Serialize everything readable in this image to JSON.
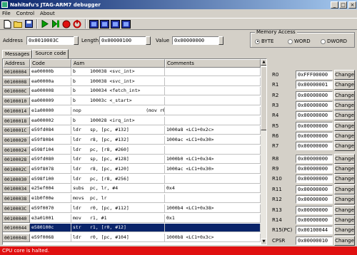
{
  "window": {
    "title": "Nahitafu's JTAG-ARM7 debugger",
    "min": "_",
    "max": "□",
    "close": "×"
  },
  "menu": [
    "File",
    "Control",
    "About"
  ],
  "toolbar": {
    "icons": [
      "new-icon",
      "open-icon",
      "save-icon",
      "run-icon",
      "step-icon",
      "stop-icon",
      "reset-icon",
      "chip-icon-1",
      "chip-icon-2",
      "chip-icon-3",
      "chip-icon-4"
    ]
  },
  "address_bar": {
    "address_label": "Address",
    "address_value": "0x0010003C",
    "length_label": "Length",
    "length_value": "0x00000100",
    "value_label": "Value",
    "value_value": "0x00000000"
  },
  "memory_access": {
    "legend": "Memory Access",
    "options": [
      "BYTE",
      "WORD",
      "DWORD"
    ],
    "selected": "BYTE"
  },
  "tabs": [
    "Messages",
    "Source code"
  ],
  "active_tab": "Source code",
  "code_table": {
    "columns": [
      "Address",
      "Code",
      "Asm",
      "Comments"
    ],
    "rows": [
      {
        "addr": "00100004",
        "code": "ea00000b",
        "op": "b",
        "args": "100038 <svc_int>",
        "comment": ""
      },
      {
        "addr": "00100008",
        "code": "ea00000a",
        "op": "b",
        "args": "100038 <svc_int>",
        "comment": ""
      },
      {
        "addr": "0010000C",
        "code": "ea000008",
        "op": "b",
        "args": "100034 <fetch_int>",
        "comment": ""
      },
      {
        "addr": "00100010",
        "code": "ea000009",
        "op": "b",
        "args": "10003c <_start>",
        "comment": ""
      },
      {
        "addr": "00100014",
        "code": "e1a00000",
        "op": "nop",
        "args": "                    (mov r0,r0",
        "comment": ""
      },
      {
        "addr": "00100018",
        "code": "ea000002",
        "op": "b",
        "args": "100028 <irq_int>",
        "comment": ""
      },
      {
        "addr": "0010001C",
        "code": "e59fd084",
        "op": "ldr",
        "args": "sp, [pc, #132]",
        "comment": "1000a8 <LC1+0x2c>"
      },
      {
        "addr": "00100020",
        "code": "e59f8084",
        "op": "ldr",
        "args": "r8, [pc, #132]",
        "comment": "1000ac <LC1+0x30>"
      },
      {
        "addr": "00100024",
        "code": "e598f104",
        "op": "ldr",
        "args": "pc, [r8, #260]",
        "comment": ""
      },
      {
        "addr": "00100028",
        "code": "e59fd080",
        "op": "ldr",
        "args": "sp, [pc, #128]",
        "comment": "1000b0 <LC1+0x34>"
      },
      {
        "addr": "0010002C",
        "code": "e59f8078",
        "op": "ldr",
        "args": "r8, [pc, #120]",
        "comment": "1000ac <LC1+0x30>"
      },
      {
        "addr": "00100030",
        "code": "e598f100",
        "op": "ldr",
        "args": "pc, [r8, #256]",
        "comment": ""
      },
      {
        "addr": "00100034",
        "code": "e25ef004",
        "op": "subs",
        "args": "pc, lr, #4",
        "comment": "0x4"
      },
      {
        "addr": "00100038",
        "code": "e1b0f00e",
        "op": "movs",
        "args": "pc, lr",
        "comment": ""
      },
      {
        "addr": "0010003C",
        "code": "e59f0070",
        "op": "ldr",
        "args": "r0, [pc, #112]",
        "comment": "1000b4 <LC1+0x38>"
      },
      {
        "addr": "00100040",
        "code": "e3a01001",
        "op": "mov",
        "args": "r1, #1",
        "comment": "0x1"
      },
      {
        "addr": "00100044",
        "code": "e580100c",
        "op": "str",
        "args": "r1, [r0, #12]",
        "comment": ""
      },
      {
        "addr": "00100048",
        "code": "e59f0068",
        "op": "ldr",
        "args": "r0, [pc, #104]",
        "comment": "1000b8 <LC1+0x3c>"
      }
    ],
    "selected_addr": "00100044"
  },
  "registers": [
    {
      "name": "R0",
      "value": "0xFFF00000"
    },
    {
      "name": "R1",
      "value": "0x00000001"
    },
    {
      "name": "R2",
      "value": "0x00000000"
    },
    {
      "name": "R3",
      "value": "0x00000000"
    },
    {
      "name": "R4",
      "value": "0x00000000"
    },
    {
      "name": "R5",
      "value": "0x00000000"
    },
    {
      "name": "R6",
      "value": "0x00000000"
    },
    {
      "name": "R7",
      "value": "0x00000000"
    },
    {
      "name": "R8",
      "value": "0x00000000"
    },
    {
      "name": "R9",
      "value": "0x00000000"
    },
    {
      "name": "R10",
      "value": "0x00000000"
    },
    {
      "name": "R11",
      "value": "0x00000000"
    },
    {
      "name": "R12",
      "value": "0x00000000"
    },
    {
      "name": "R13",
      "value": "0x00000000"
    },
    {
      "name": "R14",
      "value": "0x00000000"
    },
    {
      "name": "R15(PC)",
      "value": "0x00100044"
    },
    {
      "name": "CPSR",
      "value": "0x00000010"
    }
  ],
  "change_label": "Change",
  "status": {
    "text": "CPU core is halted.",
    "color": "#e01010"
  }
}
